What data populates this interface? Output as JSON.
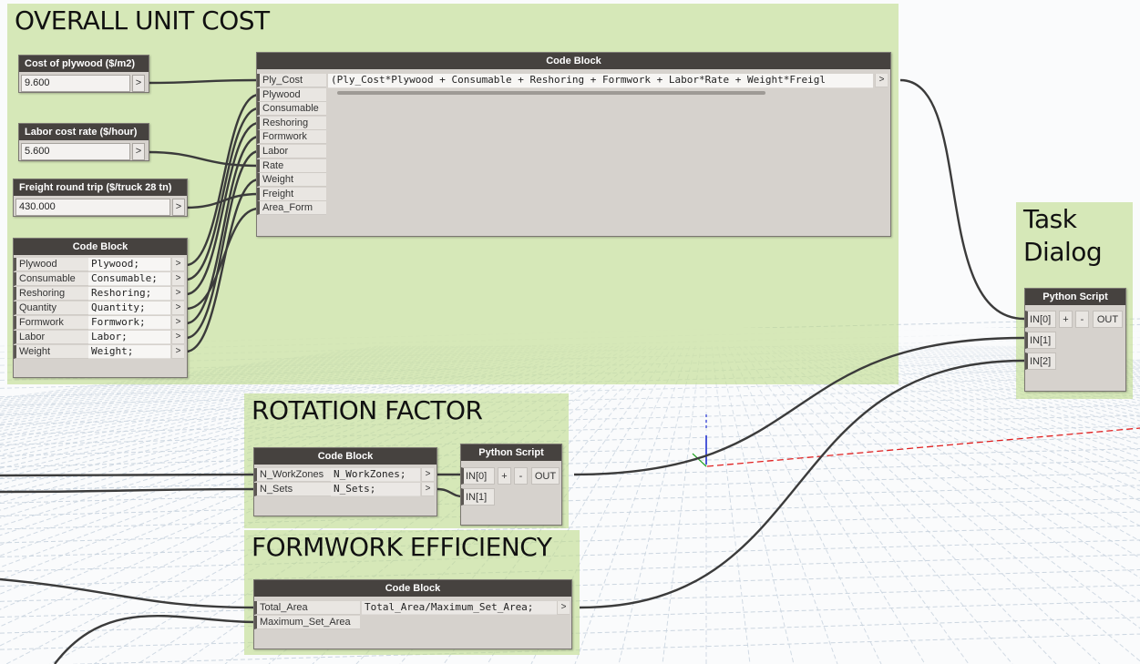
{
  "groups": {
    "overall": "OVERALL UNIT COST",
    "rotation": "ROTATION FACTOR",
    "formwork": "FORMWORK EFFICIENCY",
    "task_line1": "Task",
    "task_line2": "Dialog"
  },
  "inputs": {
    "plywood": {
      "title": "Cost of plywood ($/m2)",
      "value": "9.600",
      "arrow": ">"
    },
    "labor": {
      "title": "Labor cost rate ($/hour)",
      "value": "5.600",
      "arrow": ">"
    },
    "freight": {
      "title": "Freight round trip ($/truck 28 tn)",
      "value": "430.000",
      "arrow": ">"
    }
  },
  "code_block_small": {
    "title": "Code Block",
    "inputs": [
      "Plywood",
      "Consumable",
      "Reshoring",
      "Quantity",
      "Formwork",
      "Labor",
      "Weight"
    ],
    "code": [
      "Plywood;",
      "Consumable;",
      "Reshoring;",
      "Quantity;",
      "Formwork;",
      "Labor;",
      "Weight;"
    ],
    "out": ">"
  },
  "code_block_main": {
    "title": "Code Block",
    "inputs": [
      "Ply_Cost",
      "Plywood",
      "Consumable",
      "Reshoring",
      "Formwork",
      "Labor",
      "Rate",
      "Weight",
      "Freight",
      "Area_Form"
    ],
    "code": "(Ply_Cost*Plywood + Consumable + Reshoring + Formwork + Labor*Rate + Weight*Freigl",
    "out": ">"
  },
  "python_task": {
    "title": "Python Script",
    "inputs": [
      "IN[0]",
      "IN[1]",
      "IN[2]"
    ],
    "plus": "+",
    "minus": "-",
    "out": "OUT"
  },
  "code_block_rotation": {
    "title": "Code Block",
    "inputs": [
      "N_WorkZones",
      "N_Sets"
    ],
    "code": [
      "N_WorkZones;",
      "N_Sets;"
    ],
    "out": ">"
  },
  "python_rotation": {
    "title": "Python Script",
    "inputs": [
      "IN[0]",
      "IN[1]"
    ],
    "plus": "+",
    "minus": "-",
    "out": "OUT"
  },
  "code_block_formwork": {
    "title": "Code Block",
    "inputs": [
      "Total_Area",
      "Maximum_Set_Area"
    ],
    "code": "Total_Area/Maximum_Set_Area;",
    "out": ">"
  },
  "colors": {
    "group_fill": "#c0dc8e",
    "node_header": "#46423f",
    "node_body": "#d6d2cd",
    "wire": "#3b3b3b",
    "grid": "#c7d2dd",
    "axis_x": "#e02020",
    "axis_y": "#2030d0",
    "axis_z": "#20a020"
  }
}
